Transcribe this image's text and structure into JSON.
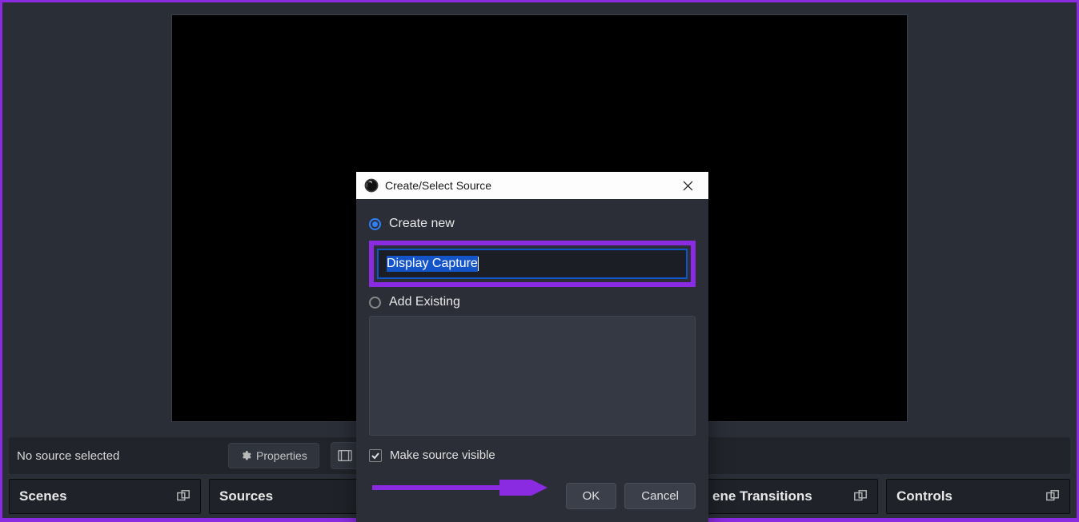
{
  "main": {
    "status_text": "No source selected",
    "properties_btn": "Properties"
  },
  "panels": {
    "scenes": "Scenes",
    "sources": "Sources",
    "transitions_partial": "ene Transitions",
    "controls": "Controls"
  },
  "dialog": {
    "title": "Create/Select Source",
    "create_new_label": "Create new",
    "name_input_value": "Display Capture",
    "add_existing_label": "Add Existing",
    "make_visible_label": "Make source visible",
    "ok_btn": "OK",
    "cancel_btn": "Cancel"
  },
  "colors": {
    "highlight": "#8a2be2",
    "accent_blue": "#1355c9"
  }
}
